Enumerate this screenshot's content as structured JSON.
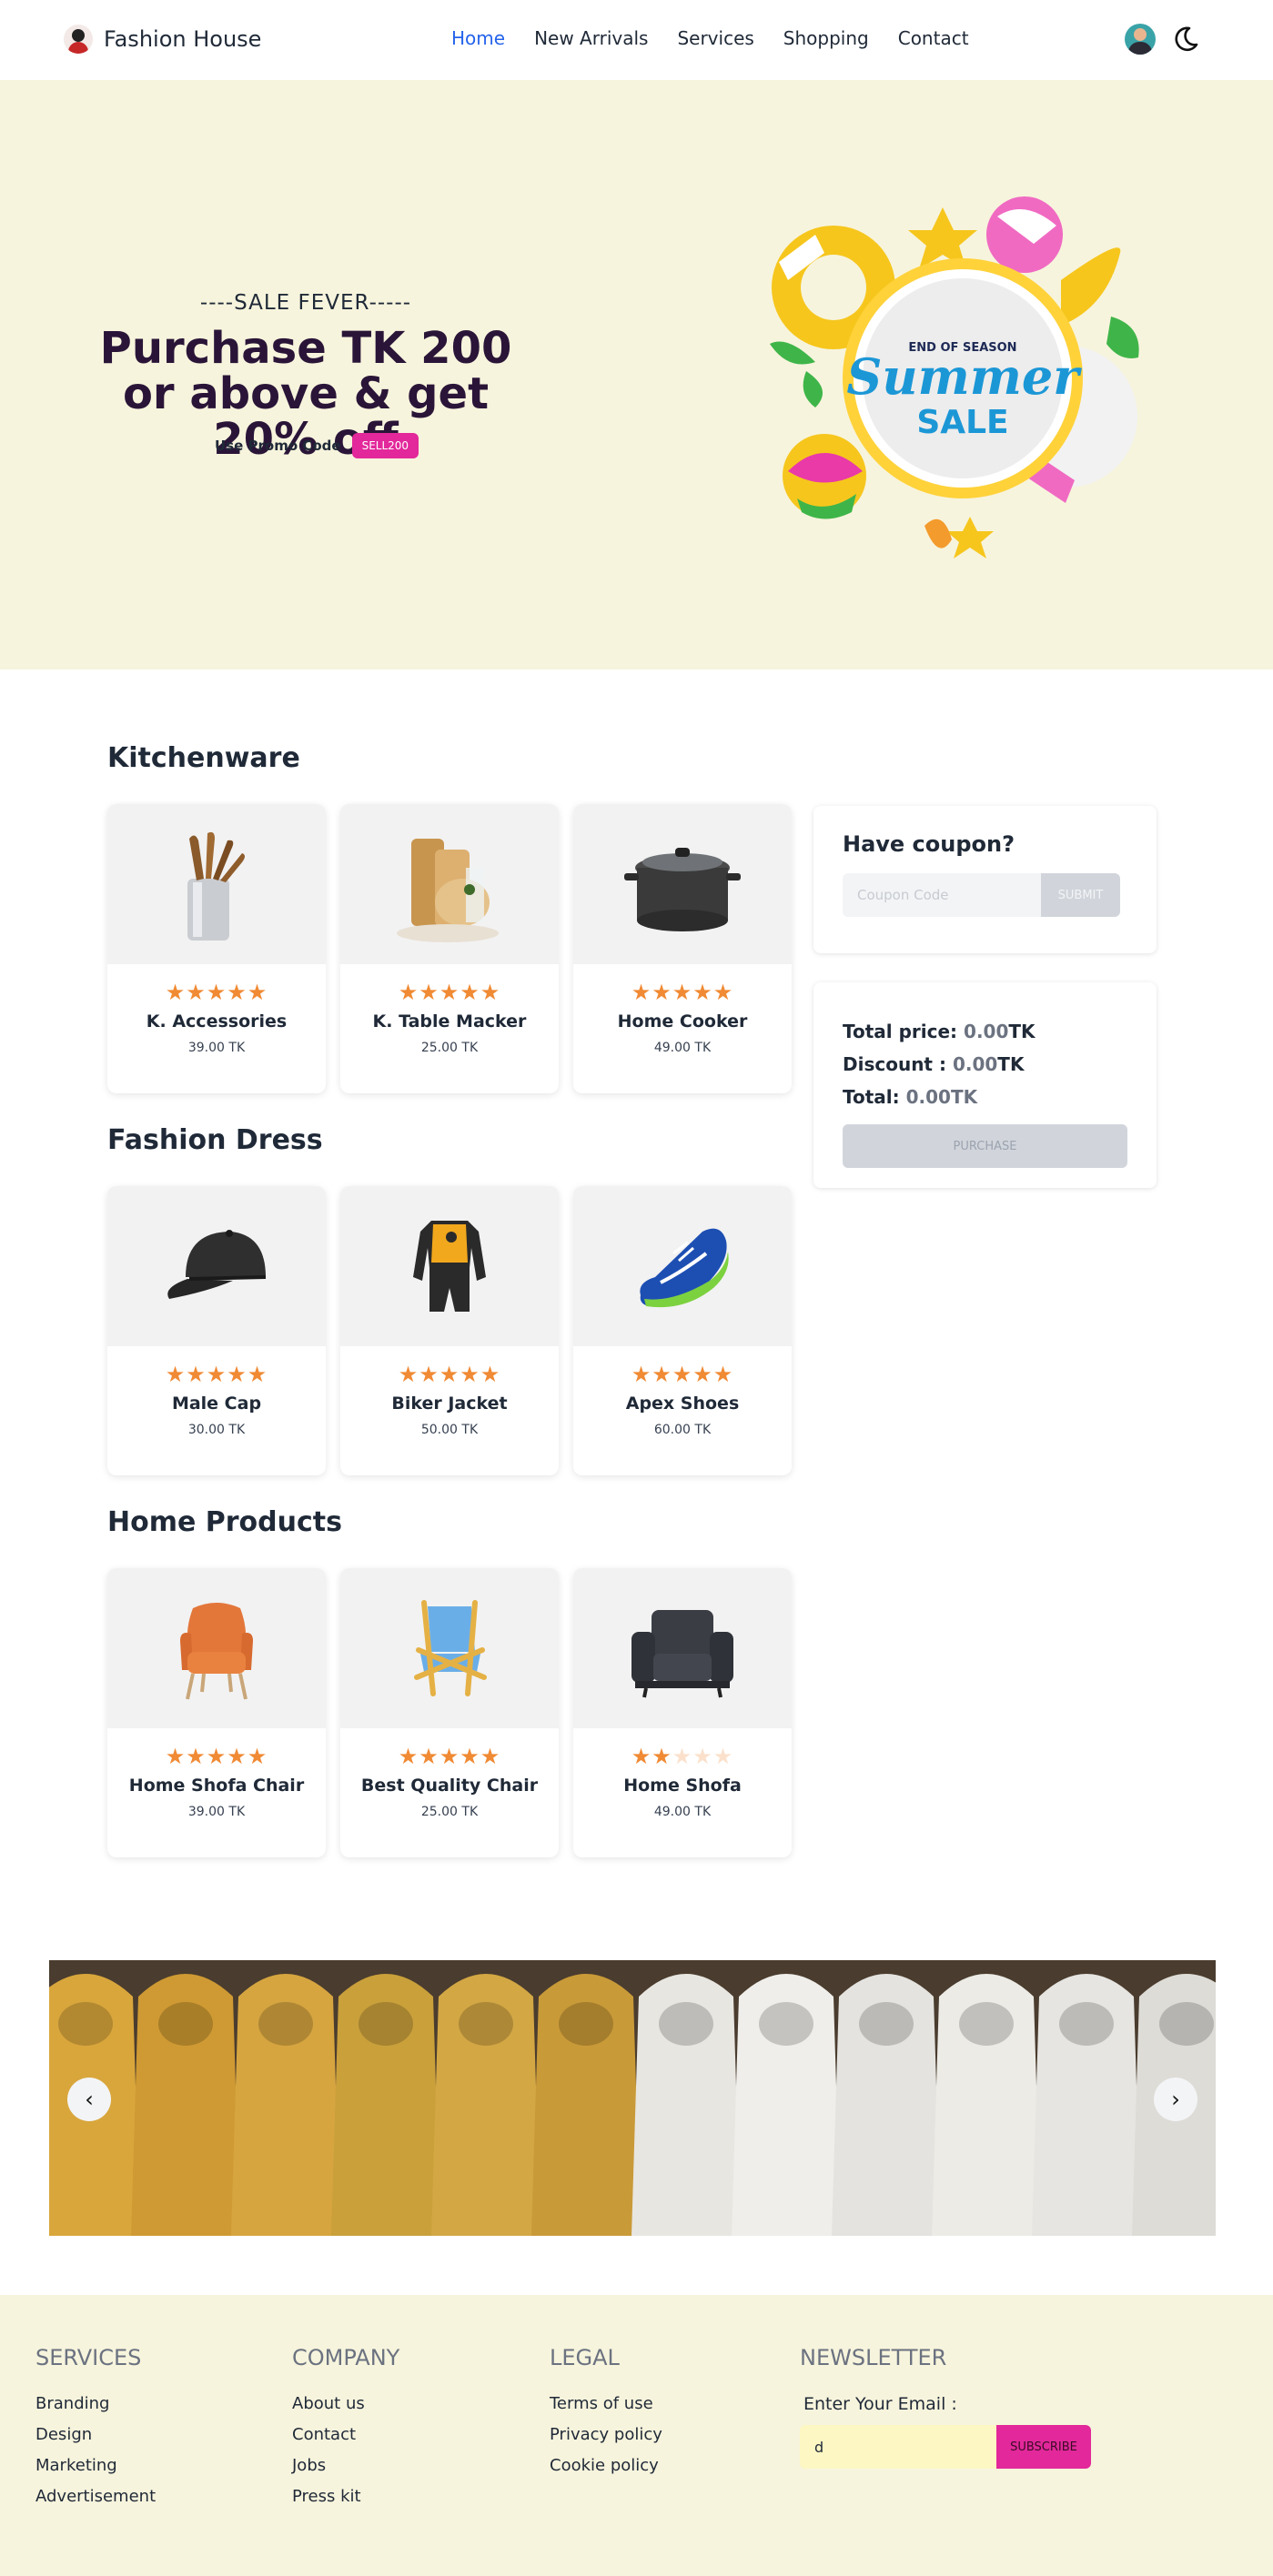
{
  "nav": {
    "brand": "Fashion House",
    "links": [
      "Home",
      "New Arrivals",
      "Services",
      "Shopping",
      "Contact"
    ],
    "active": "Home"
  },
  "hero": {
    "kicker": "----SALE FEVER-----",
    "title": "Purchase TK 200 or above & get 20% off",
    "promo_label": "Use Promo Code",
    "promo_code": "SELL200",
    "art": {
      "line1": "END OF SEASON",
      "line2": "Summer",
      "line3": "SALE"
    }
  },
  "sections": [
    {
      "title": "Kitchenware",
      "products": [
        {
          "name": "K. Accessories",
          "price": "39.00 TK",
          "rating": 5,
          "icon": "utensils-icon"
        },
        {
          "name": "K. Table Macker",
          "price": "25.00 TK",
          "rating": 5,
          "icon": "cutting-board-icon"
        },
        {
          "name": "Home Cooker",
          "price": "49.00 TK",
          "rating": 5,
          "icon": "cooking-pot-icon"
        }
      ]
    },
    {
      "title": "Fashion Dress",
      "products": [
        {
          "name": "Male Cap",
          "price": "30.00 TK",
          "rating": 5,
          "icon": "cap-icon"
        },
        {
          "name": "Biker Jacket",
          "price": "50.00 TK",
          "rating": 5,
          "icon": "jacket-icon"
        },
        {
          "name": "Apex Shoes",
          "price": "60.00 TK",
          "rating": 5,
          "icon": "shoe-icon"
        }
      ]
    },
    {
      "title": "Home Products",
      "products": [
        {
          "name": "Home Shofa Chair",
          "price": "39.00 TK",
          "rating": 5,
          "icon": "armchair-icon"
        },
        {
          "name": "Best Quality Chair",
          "price": "25.00 TK",
          "rating": 5,
          "icon": "folding-chair-icon"
        },
        {
          "name": "Home Shofa",
          "price": "49.00 TK",
          "rating": 2,
          "icon": "sofa-icon"
        }
      ]
    }
  ],
  "coupon": {
    "title": "Have coupon?",
    "placeholder": "Coupon Code",
    "submit": "SUBMIT"
  },
  "totals": {
    "total_price_label": "Total price:",
    "total_price_value": "0.00",
    "discount_label": "Discount :",
    "discount_value": "0.00",
    "total_label": "Total:",
    "total_value": "0.00TK",
    "currency": "TK",
    "purchase": "PURCHASE"
  },
  "carousel": {
    "prev": "‹",
    "next": "›"
  },
  "footer": {
    "services": {
      "title": "SERVICES",
      "links": [
        "Branding",
        "Design",
        "Marketing",
        "Advertisement"
      ]
    },
    "company": {
      "title": "COMPANY",
      "links": [
        "About us",
        "Contact",
        "Jobs",
        "Press kit"
      ]
    },
    "legal": {
      "title": "LEGAL",
      "links": [
        "Terms of use",
        "Privacy policy",
        "Cookie policy"
      ]
    },
    "newsletter": {
      "title": "NEWSLETTER",
      "email_label": "Enter Your Email :",
      "email_value": "d",
      "subscribe": "SUBSCRIBE"
    }
  },
  "colors": {
    "accent": "#2563eb",
    "promo_pink": "#e2289a",
    "hero_bg": "#f7f4dd",
    "star": "#f08a34",
    "title_dark": "#2a1538"
  }
}
